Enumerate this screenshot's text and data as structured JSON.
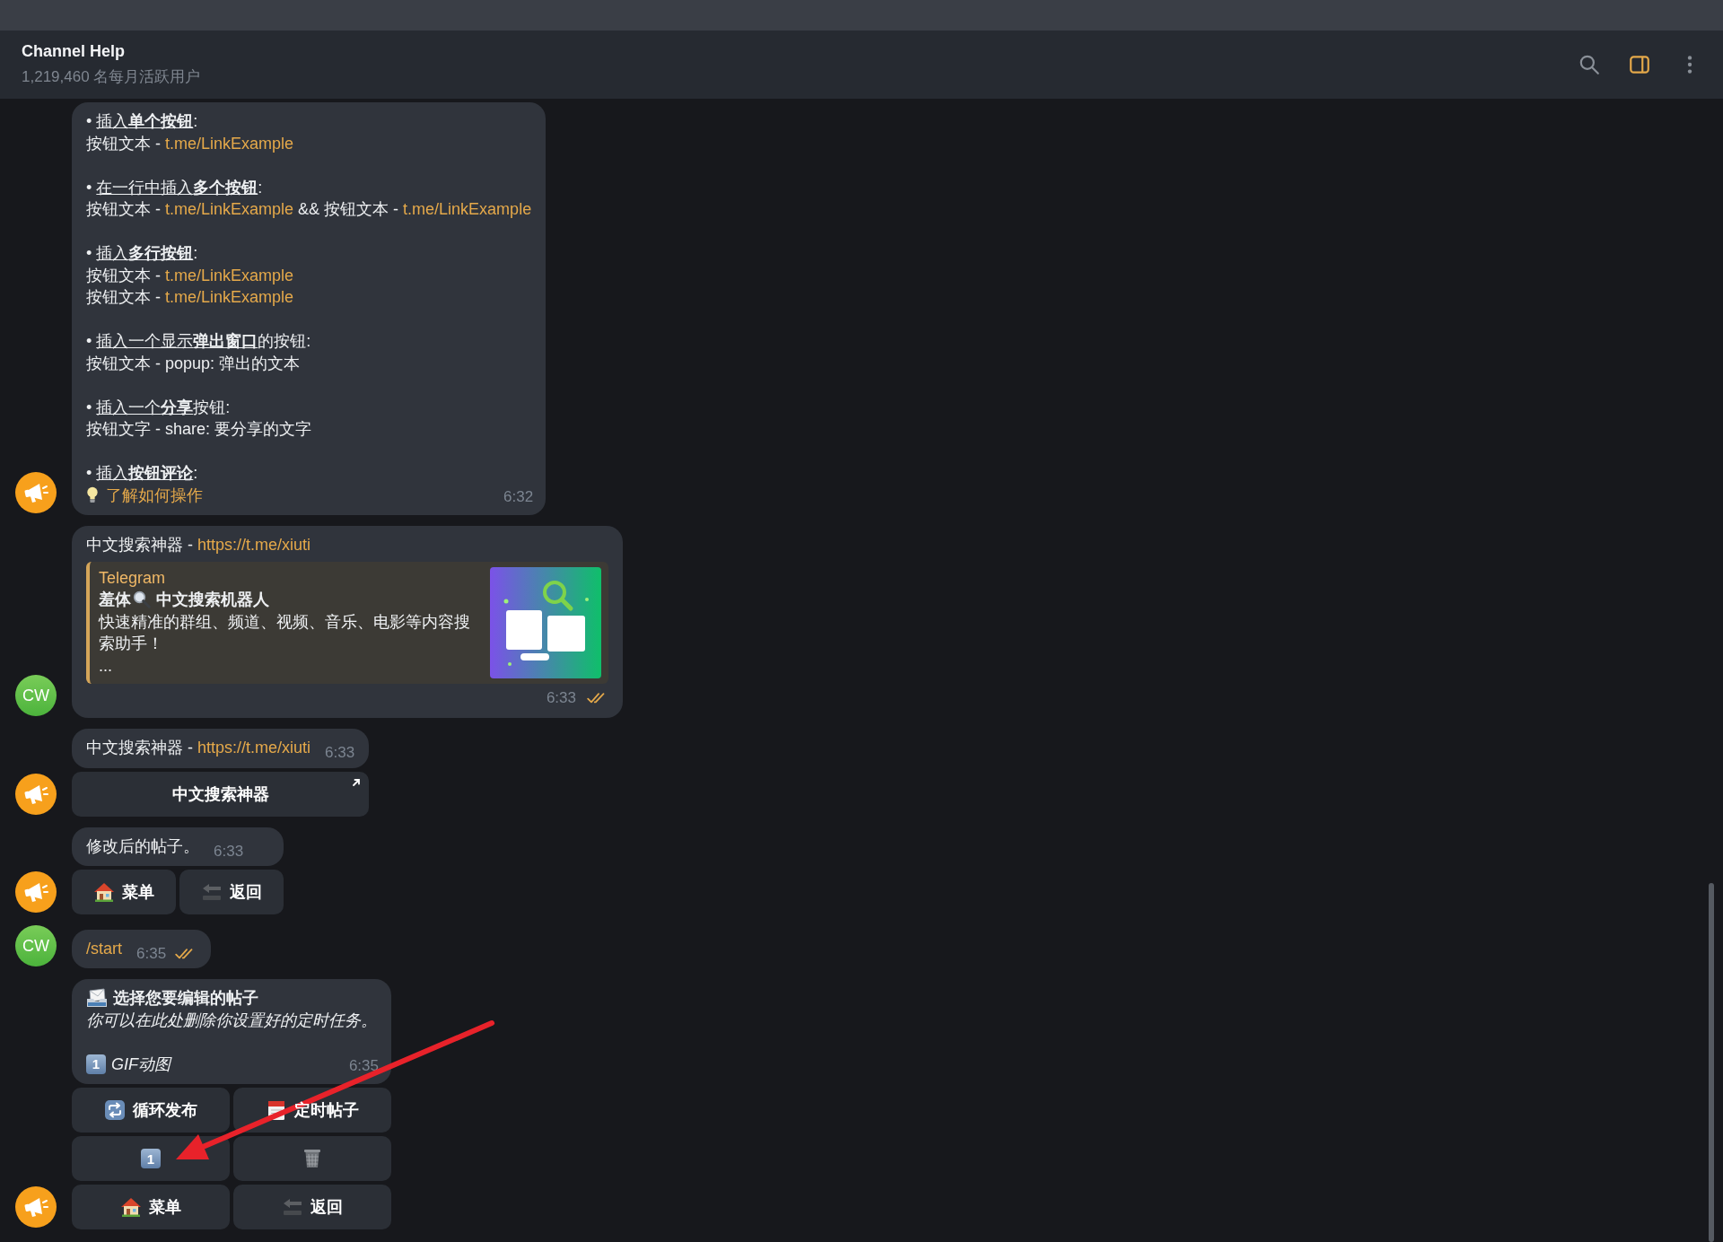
{
  "header": {
    "title": "Channel Help",
    "subtitle": "1,219,460 名每月活跃用户",
    "sidebar_open": true
  },
  "groups": [
    {
      "avatar": {
        "kind": "channel"
      },
      "messages": [
        {
          "kind": "sections",
          "time": "6:32",
          "sections": [
            {
              "bullet": "•",
              "underlined": "插入**单个按钮**",
              "colon": ":",
              "lines": [
                [
                  {
                    "kind": "text",
                    "text": "按钮文本 - "
                  },
                  {
                    "kind": "link",
                    "text": "t.me/LinkExample"
                  }
                ]
              ]
            },
            {
              "bullet": "•",
              "underlined": "在一行中插入**多个按钮**",
              "colon": ":",
              "lines": [
                [
                  {
                    "kind": "text",
                    "text": "按钮文本 - "
                  },
                  {
                    "kind": "link",
                    "text": "t.me/LinkExample"
                  },
                  {
                    "kind": "text",
                    "text": " && 按钮文本 - "
                  },
                  {
                    "kind": "link",
                    "text": "t.me/LinkExample"
                  }
                ]
              ]
            },
            {
              "bullet": "•",
              "underlined": "插入**多行按钮**",
              "colon": ":",
              "lines": [
                [
                  {
                    "kind": "text",
                    "text": "按钮文本 - "
                  },
                  {
                    "kind": "link",
                    "text": "t.me/LinkExample"
                  }
                ],
                [
                  {
                    "kind": "text",
                    "text": "按钮文本 - "
                  },
                  {
                    "kind": "link",
                    "text": "t.me/LinkExample"
                  }
                ]
              ]
            },
            {
              "bullet": "•",
              "underlined": "插入一个显示**弹出窗口**",
              "rest": "的按钮",
              "colon": ":",
              "lines": [
                [
                  {
                    "kind": "text",
                    "text": "按钮文本 - popup: 弹出的文本"
                  }
                ]
              ]
            },
            {
              "bullet": "•",
              "underlined": "插入一个**分享**",
              "rest": "按钮",
              "colon": ":",
              "lines": [
                [
                  {
                    "kind": "text",
                    "text": "按钮文字 - share: 要分享的文字"
                  }
                ]
              ]
            },
            {
              "bullet": "•",
              "underlined": "插入**按钮评论**",
              "colon": ":",
              "lines": [
                [
                  {
                    "kind": "tip",
                    "text": "了解如何操作"
                  }
                ]
              ]
            }
          ]
        }
      ]
    },
    {
      "avatar": {
        "kind": "user",
        "initials": "CW"
      },
      "messages": [
        {
          "kind": "preview",
          "parts": [
            {
              "kind": "text",
              "text": "中文搜索神器 - "
            },
            {
              "kind": "link",
              "text": "https://t.me/xiuti"
            }
          ],
          "preview": {
            "site": "Telegram",
            "title_start": "羞体",
            "title_end": "中文搜索机器人",
            "description": "快速精准的群组、频道、视频、音乐、电影等内容搜索助手！",
            "more": "..."
          },
          "time": "6:33",
          "read": true
        }
      ]
    },
    {
      "avatar": {
        "kind": "channel"
      },
      "messages": [
        {
          "kind": "text",
          "parts": [
            {
              "kind": "text",
              "text": "中文搜索神器 - "
            },
            {
              "kind": "link",
              "text": "https://t.me/xiuti"
            }
          ],
          "time": "6:33",
          "keyboard": [
            [
              {
                "label": "中文搜索神器",
                "kind": "link"
              }
            ]
          ]
        }
      ]
    },
    {
      "avatar": {
        "kind": "channel"
      },
      "messages": [
        {
          "kind": "text",
          "parts": [
            {
              "kind": "text",
              "text": "修改后的帖子。"
            }
          ],
          "time": "6:33",
          "keyboard": [
            [
              {
                "label": "菜单",
                "kind": "house"
              },
              {
                "label": "返回",
                "kind": "back"
              }
            ]
          ]
        }
      ]
    },
    {
      "avatar": {
        "kind": "user",
        "initials": "CW"
      },
      "messages": [
        {
          "kind": "text",
          "parts": [
            {
              "kind": "command",
              "text": "/start"
            }
          ],
          "time": "6:35",
          "read": true
        }
      ]
    },
    {
      "avatar": {
        "kind": "channel"
      },
      "messages": [
        {
          "kind": "menu",
          "title": "选择您要编辑的帖子",
          "note": "你可以在此处删除你设置好的定时任务。",
          "item": {
            "badge": "1",
            "text": "GIF动图"
          },
          "time": "6:35",
          "keyboard": [
            [
              {
                "label": "循环发布",
                "kind": "repeat"
              },
              {
                "label": "定时帖子",
                "kind": "calendar"
              }
            ],
            [
              {
                "label": "1",
                "kind": "keycap"
              },
              {
                "kind": "trash"
              }
            ],
            [
              {
                "label": "菜单",
                "kind": "house"
              },
              {
                "label": "返回",
                "kind": "back"
              }
            ]
          ]
        }
      ]
    }
  ]
}
